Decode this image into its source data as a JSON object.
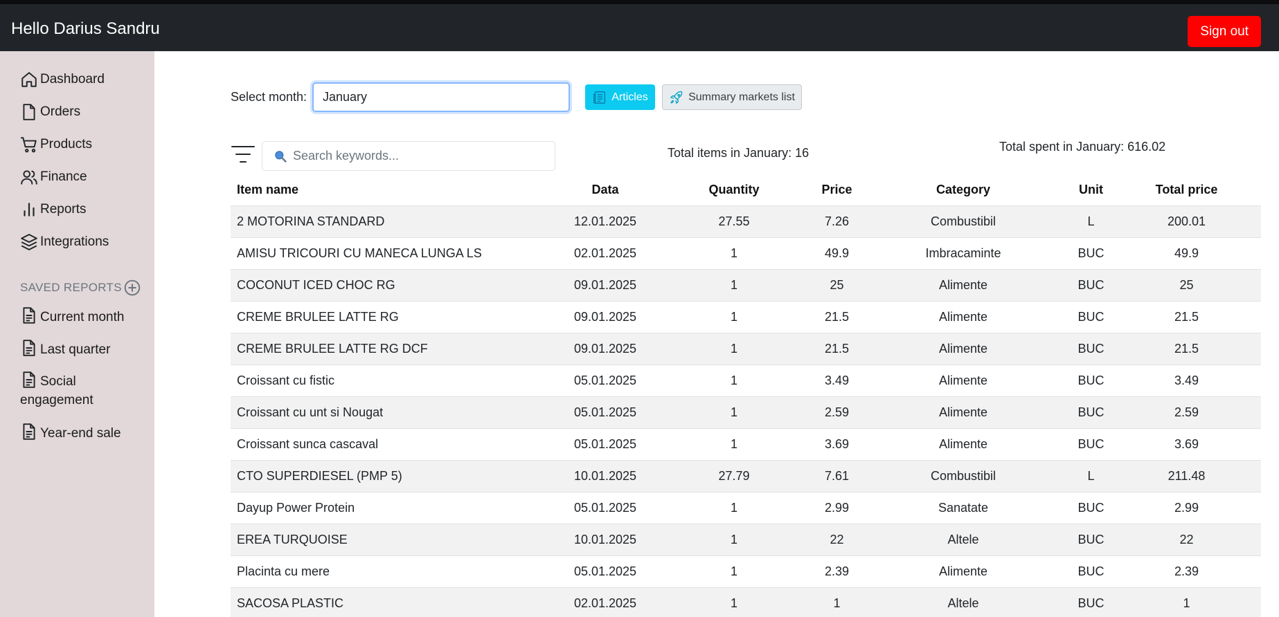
{
  "header": {
    "greeting": "Hello Darius Sandru",
    "signout_label": "Sign out"
  },
  "sidebar": {
    "items": [
      {
        "label": "Dashboard",
        "icon": "home-icon"
      },
      {
        "label": "Orders",
        "icon": "file-icon"
      },
      {
        "label": "Products",
        "icon": "shopping-cart-icon"
      },
      {
        "label": "Finance",
        "icon": "users-icon"
      },
      {
        "label": "Reports",
        "icon": "bar-chart-icon"
      },
      {
        "label": "Integrations",
        "icon": "layers-icon"
      }
    ],
    "saved_reports_heading": "SAVED REPORTS",
    "saved_reports": [
      {
        "label": "Current month",
        "icon": "file-text-icon"
      },
      {
        "label": "Last quarter",
        "icon": "file-text-icon"
      },
      {
        "label": "Social engagement",
        "icon": "file-text-icon"
      },
      {
        "label": "Year-end sale",
        "icon": "file-text-icon"
      }
    ]
  },
  "controls": {
    "month_label": "Select month:",
    "month_value": "January",
    "articles_label": "Articles",
    "summary_label": "Summary markets list",
    "search_placeholder": "Search keywords...",
    "total_items": "Total items in January: 16",
    "total_spent": "Total spent in January: 616.02"
  },
  "table": {
    "columns": [
      "Item name",
      "Data",
      "Quantity",
      "Price",
      "Category",
      "Unit",
      "Total price"
    ],
    "rows": [
      [
        "2 MOTORINA STANDARD",
        "12.01.2025",
        "27.55",
        "7.26",
        "Combustibil",
        "L",
        "200.01"
      ],
      [
        "AMISU TRICOURI CU MANECA LUNGA LS",
        "02.01.2025",
        "1",
        "49.9",
        "Imbracaminte",
        "BUC",
        "49.9"
      ],
      [
        "COCONUT ICED CHOC RG",
        "09.01.2025",
        "1",
        "25",
        "Alimente",
        "BUC",
        "25"
      ],
      [
        "CREME BRULEE LATTE RG",
        "09.01.2025",
        "1",
        "21.5",
        "Alimente",
        "BUC",
        "21.5"
      ],
      [
        "CREME BRULEE LATTE RG DCF",
        "09.01.2025",
        "1",
        "21.5",
        "Alimente",
        "BUC",
        "21.5"
      ],
      [
        "Croissant cu fistic",
        "05.01.2025",
        "1",
        "3.49",
        "Alimente",
        "BUC",
        "3.49"
      ],
      [
        "Croissant cu unt si Nougat",
        "05.01.2025",
        "1",
        "2.59",
        "Alimente",
        "BUC",
        "2.59"
      ],
      [
        "Croissant sunca cascaval",
        "05.01.2025",
        "1",
        "3.69",
        "Alimente",
        "BUC",
        "3.69"
      ],
      [
        "CTO SUPERDIESEL (PMP 5)",
        "10.01.2025",
        "27.79",
        "7.61",
        "Combustibil",
        "L",
        "211.48"
      ],
      [
        "Dayup Power Protein",
        "05.01.2025",
        "1",
        "2.99",
        "Sanatate",
        "BUC",
        "2.99"
      ],
      [
        "EREA TURQUOISE",
        "10.01.2025",
        "1",
        "22",
        "Altele",
        "BUC",
        "22"
      ],
      [
        "Placinta cu mere",
        "05.01.2025",
        "1",
        "2.39",
        "Alimente",
        "BUC",
        "2.39"
      ],
      [
        "SACOSA PLASTIC",
        "02.01.2025",
        "1",
        "1",
        "Altele",
        "BUC",
        "1"
      ]
    ]
  },
  "colors": {
    "topbar": "#212529",
    "signout": "#ff0000",
    "sidebar": "#e2d8d9",
    "articles_button": "#0dcaf0"
  }
}
